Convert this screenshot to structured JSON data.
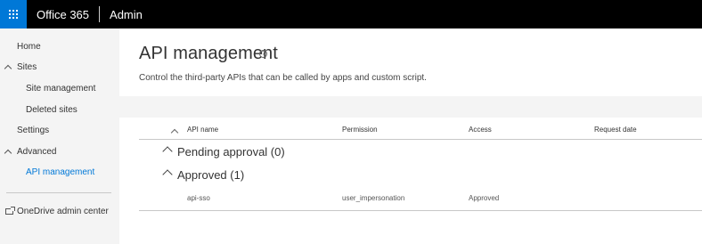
{
  "topbar": {
    "waffle_icon": "app-launcher-icon",
    "brand": "Office 365",
    "app": "Admin",
    "accent": "#0078d7"
  },
  "sidebar": {
    "home": "Home",
    "sites": "Sites",
    "site_management": "Site management",
    "deleted_sites": "Deleted sites",
    "settings": "Settings",
    "advanced": "Advanced",
    "api_management": "API management",
    "onedrive": "OneDrive admin center"
  },
  "main": {
    "title": "API management",
    "help_icon": "?",
    "description": "Control the third-party APIs that can be called by apps and custom script.",
    "columns": {
      "api_name": "API name",
      "permission": "Permission",
      "access": "Access",
      "request_date": "Request date"
    },
    "groups": {
      "pending": "Pending approval (0)",
      "approved": "Approved (1)"
    },
    "rows": [
      {
        "api_name": "api-sso",
        "permission": "user_impersonation",
        "access": "Approved",
        "request_date": ""
      }
    ]
  }
}
